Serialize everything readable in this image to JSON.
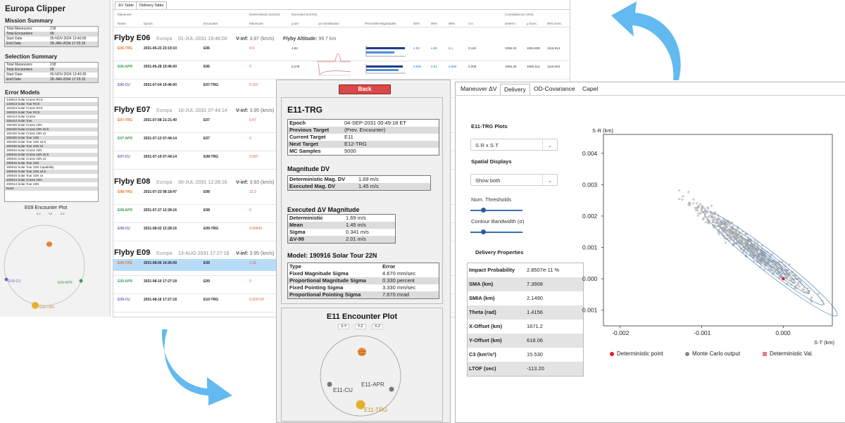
{
  "left_panel": {
    "app_title": "Europa Clipper",
    "mission_summary": {
      "title": "Mission Summary",
      "rows": [
        {
          "label": "Total Maneuvers",
          "value": "218"
        },
        {
          "label": "Total Encounters",
          "value": "68"
        },
        {
          "label": "Start Date",
          "value": "05-NOV-2024 13:40:30"
        },
        {
          "label": "End Date",
          "value": "28-JAN-2034 17:25:15"
        }
      ]
    },
    "selection_summary": {
      "title": "Selection Summary",
      "rows": [
        {
          "label": "Total Maneuvers",
          "value": "218"
        },
        {
          "label": "Total Encounters",
          "value": "68"
        },
        {
          "label": "Start Date",
          "value": "05-NOV-2024 13:40:30"
        },
        {
          "label": "End Date",
          "value": "28-JAN-2034 17:25:15"
        }
      ]
    },
    "error_models": {
      "title": "Error Models",
      "items": [
        "140813 Solar Cruise RCS",
        "140813 Solar Tour RCS",
        "150323 Solar Cruise RCS",
        "150323 Solar Tour RCS",
        "150413 Solar Cruise",
        "150413 Solar Tour",
        "150430 Solar Cruise 22N",
        "150430 Solar Cruise 22N x0.5",
        "150430 Solar Cruise 22N x2",
        "150430 Solar Tour 22N",
        "150430 Solar Tour 22N x0.5",
        "150430 Solar Tour 22N x2",
        "190916 Solar Cruise 22N",
        "190916 Solar Cruise 22N x0.5",
        "190916 Solar Cruise 22N x2",
        "190916 Solar Tour 22N",
        "190916 Solar Tour 22N Capability",
        "190916 Solar Tour 22N x0.5",
        "190916 Solar Tour 22N x2",
        "200514 Solar Cruise 22N",
        "200514 Solar Tour 22N",
        "None"
      ]
    },
    "encounter_plot": {
      "title": "E09 Encounter Plot",
      "tabs": [
        "X-Y",
        "Y-Z",
        "X-Z"
      ],
      "labels": {
        "cu": "E09-CU",
        "apr": "E09-APR",
        "trg": "E09-TRG"
      }
    }
  },
  "dv_table": {
    "tabs": [
      "ΔV Table",
      "Delivery Table"
    ],
    "column_groups": {
      "maneuver": "Maneuver",
      "deterministic": "Deterministic ΔV(m/s)",
      "executed": "Executed ΔV(m/s)",
      "cumulated": "Cumulated ΔV (m/s)"
    },
    "columns": [
      "Name",
      "Epoch",
      "Encounter",
      "Maneuver",
      "μ-ΔV",
      "ΔV Distribution",
      "Percentile Magnitudes",
      "50%",
      "95%",
      "99%",
      "1-σ",
      "Determ.",
      "μ Exec.",
      "99% Exec."
    ],
    "flybys": [
      {
        "name": "Flyby E06",
        "body": "Europa",
        "date": "01-JUL-2031 19:46:00",
        "vinf": "V-inf:",
        "vinf_value": "3.97 (km/s)",
        "altitude": "Flyby Altitude:",
        "altitude_value": "99.7 km",
        "rows": [
          {
            "name": "E06-TRG",
            "epoch": "2031-06-23 23:19:10",
            "encounter": "E06",
            "maneuver": "4.9",
            "mu": "4.84",
            "p50": "4.93",
            "p95": "4.96",
            "p99": "5.1",
            "sigma": "0.119",
            "determ": "1058.33",
            "mu_exec": "1064.835",
            "p99_exec": "1116.913"
          },
          {
            "name": "E06-APR",
            "epoch": "2031-06-28 19:46:00",
            "encounter": "E06",
            "maneuver": "0",
            "mu": "0.278",
            "p50": "0.566",
            "p95": "0.64",
            "p99": "0.690",
            "sigma": "0.208",
            "determ": "1058.33",
            "mu_exec": "1065.113",
            "p99_exec": "1116.003"
          },
          {
            "name": "E06-CU",
            "epoch": "2031-07-04 19:46:00",
            "encounter": "E07-TRG",
            "maneuver": "0.101"
          }
        ]
      },
      {
        "name": "Flyby E07",
        "body": "Europa",
        "date": "16-JUL-2031 07:44:14",
        "vinf": "V-inf:",
        "vinf_value": "3.95 (km/s)",
        "rows": [
          {
            "name": "E07-TRG",
            "epoch": "2031-07-08 21:21:40",
            "encounter": "E07",
            "maneuver": "0.47"
          },
          {
            "name": "E07-APR",
            "epoch": "2031-07-13 07:44:14",
            "encounter": "E07",
            "maneuver": "0"
          },
          {
            "name": "E07-CU",
            "epoch": "2031-07-19 07:44:14",
            "encounter": "E08-TRG",
            "maneuver": "0.097"
          }
        ]
      },
      {
        "name": "Flyby E08",
        "body": "Europa",
        "date": "30-JUL-2031 12:28:16",
        "vinf": "V-inf:",
        "vinf_value": "3.93 (km/s)",
        "rows": [
          {
            "name": "E08-TRG",
            "epoch": "2031-07-23 08:18:47",
            "encounter": "E08",
            "maneuver": "12.3"
          },
          {
            "name": "E08-APR",
            "epoch": "2031-07-27 12:28:16",
            "encounter": "E08",
            "maneuver": "0"
          },
          {
            "name": "E08-CU",
            "epoch": "2031-08-02 12:28:16",
            "encounter": "E09-TRG",
            "maneuver": "0.00543"
          }
        ]
      },
      {
        "name": "Flyby E09",
        "body": "Europa",
        "date": "13-AUG-2031 17:27:18",
        "vinf": "V-inf:",
        "vinf_value": "3.95 (km/s)",
        "rows": [
          {
            "name": "E09-TRG",
            "epoch": "2031-08-06 14:26:00",
            "encounter": "E09",
            "maneuver": "2.19"
          },
          {
            "name": "E09-APR",
            "epoch": "2031-08-10 17:27:18",
            "encounter": "E09",
            "maneuver": "0"
          },
          {
            "name": "E09-CU",
            "epoch": "2031-08-16 17:27:18",
            "encounter": "E10-TRG",
            "maneuver": "0.000726"
          }
        ]
      }
    ]
  },
  "mid": {
    "back_label": "Back",
    "title": "E11-TRG",
    "info_rows": [
      {
        "label": "Epoch",
        "value": "04-SEP-2031 00:49:18 ET"
      },
      {
        "label": "Previous Target",
        "value": "(Prev. Encounter)"
      },
      {
        "label": "Current Target",
        "value": "E11"
      },
      {
        "label": "Next Target",
        "value": "E12-TRG"
      },
      {
        "label": "MC Samples",
        "value": "5000"
      }
    ],
    "magnitude_title": "Magnitude DV",
    "magnitude_rows": [
      {
        "label": "Deterministic Mag. DV",
        "value": "1.69 m/s"
      },
      {
        "label": "Executed Mag. DV",
        "value": "1.45 m/s"
      }
    ],
    "executed_title": "Executed ΔV Magnitude",
    "executed_rows": [
      {
        "label": "Deterministic",
        "value": "1.69 m/s"
      },
      {
        "label": "Mean",
        "value": "1.45 m/s"
      },
      {
        "label": "Sigma",
        "value": "0.341 m/s"
      },
      {
        "label": "ΔV-99",
        "value": "2.01 m/s"
      }
    ],
    "model_title": "Model: 190916 Solar Tour 22N",
    "model_header": {
      "type": "Type",
      "error": "Error"
    },
    "model_rows": [
      {
        "label": "Fixed Magnitude Sigma",
        "value": "4.670 mm/sec"
      },
      {
        "label": "Proportional Magnitude Sigma",
        "value": "0.330 percent"
      },
      {
        "label": "Fixed Pointing Sigma",
        "value": "3.330 mm/sec"
      },
      {
        "label": "Proportional Pointing Sigma",
        "value": "7.670 mrad"
      }
    ],
    "plot_title": "E11 Encounter Plot",
    "plot_tabs": [
      "X-Y",
      "Y-Z",
      "X-Z"
    ],
    "plot_labels": {
      "cu": "E11-CU",
      "apr": "E11-APR",
      "trg": "E11-TRG"
    }
  },
  "right": {
    "tabs": [
      "Maneuver ΔV",
      "Delivery",
      "OD-Covariance",
      "Capel"
    ],
    "active_tab": "Delivery",
    "plots_title": "E11-TRG Plots",
    "plot_select": "S·R x S·T",
    "spatial_title": "Spatial Displays",
    "spatial_select": "Show both",
    "num_thresholds": "Num. Thresholds",
    "contour_bandwidth": "Contour Bandwidth (σ)",
    "props_title": "Delivery Properties",
    "properties": [
      {
        "label": "Impact Probability",
        "value": "2.8507e-11 %"
      },
      {
        "label": "SMA (km)",
        "value": "7.3968"
      },
      {
        "label": "SMIA (km)",
        "value": "2.1490"
      },
      {
        "label": "Theta (rad)",
        "value": "1.4156"
      },
      {
        "label": "X-Offset (km)",
        "value": "1671.2"
      },
      {
        "label": "Y-Offset (km)",
        "value": "618.06"
      },
      {
        "label": "C3 (km²/s²)",
        "value": "15.530"
      },
      {
        "label": "LTOF (sec)",
        "value": "-113.20"
      }
    ],
    "legend": [
      {
        "label": "Deterministic point",
        "color": "#e02020"
      },
      {
        "label": "Monte Carlo output",
        "color": "#888888"
      },
      {
        "label": "Deterministic Val.",
        "color": "#e07c8c"
      }
    ]
  },
  "chart_data": {
    "type": "scatter",
    "ylabel": "S·R (km)",
    "xlabel": "S·T (km)",
    "x_ticks": [
      "-0.002",
      "-0.001",
      "0.000"
    ],
    "y_ticks": [
      "0.004",
      "0.003",
      "0.002",
      "0.001",
      "0.000",
      "0.001"
    ],
    "xlim": [
      -0.0022,
      0.0006
    ],
    "ylim": [
      -0.0015,
      0.0046
    ],
    "deterministic_point": {
      "x": 0.0,
      "y": 0.0
    },
    "monte_carlo_axis": {
      "x_start": -0.00195,
      "y_start": 0.00415,
      "x_end": 0.0005,
      "y_end": -0.00085
    }
  }
}
